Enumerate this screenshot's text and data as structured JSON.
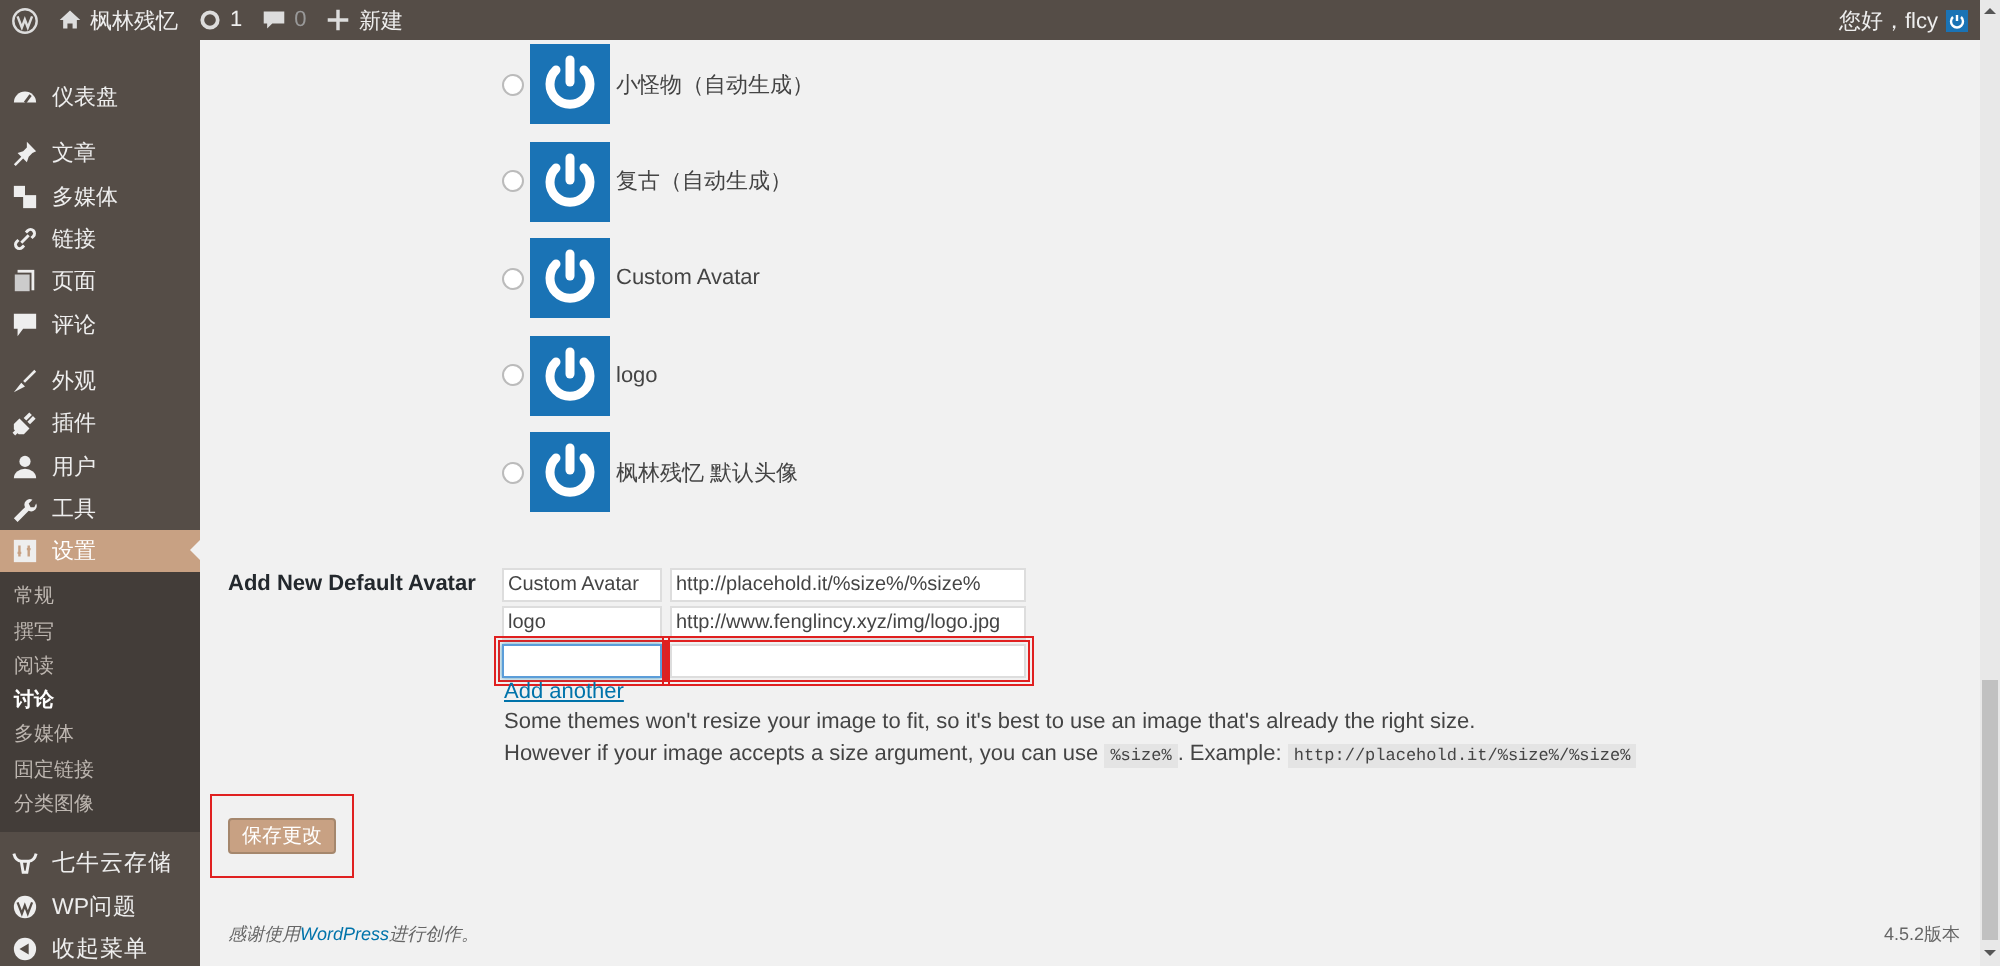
{
  "admin_bar": {
    "site_name": "枫林残忆",
    "updates": "1",
    "comments": "0",
    "new": "新建",
    "greeting": "您好，flcy"
  },
  "sidebar": {
    "groups": [
      [
        {
          "label": "仪表盘",
          "selected": false
        }
      ],
      [
        {
          "label": "文章",
          "selected": false
        },
        {
          "label": "多媒体",
          "selected": false
        },
        {
          "label": "链接",
          "selected": false
        },
        {
          "label": "页面",
          "selected": false
        },
        {
          "label": "评论",
          "selected": false
        }
      ],
      [
        {
          "label": "外观",
          "selected": false
        },
        {
          "label": "插件",
          "selected": false
        },
        {
          "label": "用户",
          "selected": false
        },
        {
          "label": "工具",
          "selected": false
        },
        {
          "label": "设置",
          "selected": true,
          "children": [
            {
              "label": "常规",
              "selected": false
            },
            {
              "label": "撰写",
              "selected": false
            },
            {
              "label": "阅读",
              "selected": false
            },
            {
              "label": "讨论",
              "selected": true
            },
            {
              "label": "多媒体",
              "selected": false
            },
            {
              "label": "固定链接",
              "selected": false
            },
            {
              "label": "分类图像",
              "selected": false
            }
          ]
        }
      ],
      [
        {
          "label": "七牛云存储",
          "selected": false
        },
        {
          "label": "WP问题",
          "selected": false
        },
        {
          "label": "收起菜单",
          "selected": false
        }
      ]
    ]
  },
  "avatars": [
    {
      "label": "小怪物（自动生成）",
      "selected": false
    },
    {
      "label": "复古（自动生成）",
      "selected": false
    },
    {
      "label": "Custom Avatar",
      "selected": false
    },
    {
      "label": "logo",
      "selected": false
    },
    {
      "label": "枫林残忆 默认头像",
      "selected": false
    }
  ],
  "default_avatar_form": {
    "label": "Add New Default Avatar",
    "rows": [
      {
        "name": "Custom Avatar",
        "url": "http://placehold.it/%size%/%size%",
        "focused": false,
        "highlighted": false
      },
      {
        "name": "logo",
        "url": "http://www.fenglincy.xyz/img/logo.jpg",
        "focused": false,
        "highlighted": false
      },
      {
        "name": "",
        "url": "",
        "focused": true,
        "highlighted": true
      }
    ],
    "add_link": "Add another",
    "help": [
      [
        {
          "kind": "text",
          "text": "Some themes won't resize your image to fit, so it's best to use an image that's already the right size."
        }
      ],
      [
        {
          "kind": "text",
          "text": "However if your image accepts a size argument, you can use "
        },
        {
          "kind": "code",
          "text": "%size%"
        },
        {
          "kind": "text",
          "text": ". Example: "
        },
        {
          "kind": "code",
          "text": "http://placehold.it/%size%/%size%"
        }
      ]
    ]
  },
  "save_button": {
    "label": "保存更改",
    "highlighted": true
  },
  "footer": {
    "thanks_before": "感谢使用",
    "thanks_link": "WordPress",
    "thanks_after": "进行创作。",
    "version": "4.5.2版本"
  }
}
